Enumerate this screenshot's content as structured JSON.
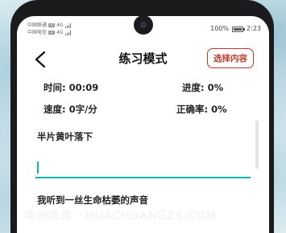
{
  "status_bar": {
    "carrier_1": "中国联通",
    "carrier_2": "中国电信",
    "network_1": "4G",
    "network_2": "4G",
    "battery": "100%",
    "time": "2:23"
  },
  "header": {
    "title": "练习模式",
    "select_button": "选择内容"
  },
  "stats": {
    "time_label": "时间: 00:09",
    "progress_label": "进度: 0%",
    "speed_label": "速度: 0字/分",
    "accuracy_label": "正确率: 0%"
  },
  "practice": {
    "current_line": "半片黄叶落下",
    "input_value": "",
    "next_line": "我听到一丝生命枯萎的声音"
  },
  "watermark": "华创应用 · HUACHUANGZS.COM",
  "colors": {
    "accent": "#19b3ad",
    "select_button": "#c0392b"
  }
}
